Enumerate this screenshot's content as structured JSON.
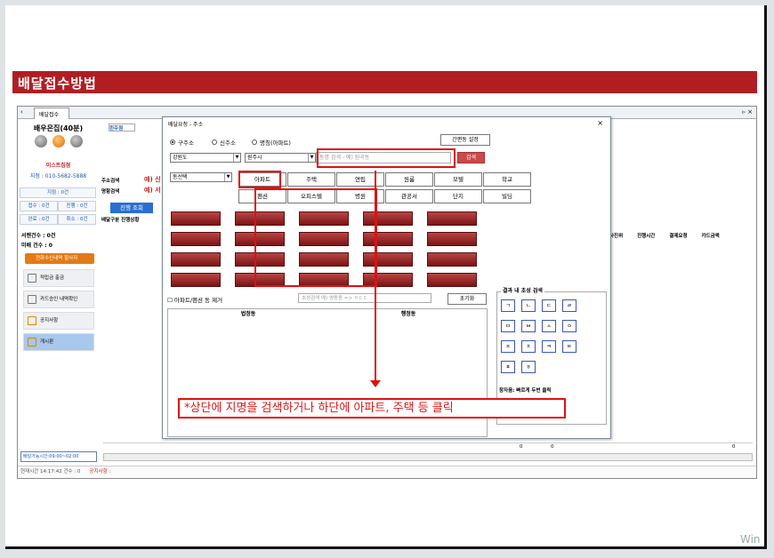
{
  "banner": {
    "title": "배달접수방법"
  },
  "app": {
    "tab": "배달접수",
    "store_name": "배우은집(40분)",
    "store_label": "이스트집점",
    "phone": "지점 : 010-5682-5888",
    "stats": [
      [
        "지점 : 0건"
      ],
      [
        "접수 : 0건",
        "진행 : 0건"
      ],
      [
        "완료 : 0건",
        "취소 : 0건"
      ]
    ],
    "counts": [
      "서렌건수 : 0건",
      "미배 건수 : 0"
    ],
    "orange_btn": "전화수신내역 할사자",
    "menu": [
      "적립금 출금",
      "카드승인 내역확인",
      "공지사항",
      "게시판"
    ],
    "delivery_time": "배달가능시간:09:00~02:00",
    "status_text": "현재시간 14:17:42   건수 : 0",
    "status_notice": "공지사항 :",
    "mid_labels": [
      "왼주점",
      "주소검색",
      "명함검색",
      "배달구분  진행상황",
      "진행 조회",
      "예) 신",
      "예) 서"
    ],
    "grid_headers": [
      "사진위",
      "진행시간",
      "결제요청",
      "카드금액"
    ],
    "totals": [
      "0",
      "0",
      "0"
    ]
  },
  "dialog": {
    "title": "배달요청 - 주소",
    "close": "×",
    "radios": [
      "구주소",
      "신주소",
      "명칭(아파트)"
    ],
    "manage_btn": "간편동 설정",
    "region1": "강원도",
    "region2": "원주시",
    "region3": "동선택",
    "search_placeholder": "동명 검색 - 예) 원곡동",
    "search_btn": "검색",
    "categories_row1": [
      "아파트",
      "주택",
      "연립",
      "원룸",
      "모텔",
      "학교"
    ],
    "categories_row2": [
      "펜션",
      "오피스텔",
      "병원",
      "관공서",
      "단지",
      "빌딩"
    ],
    "checkbox_label": "아파트/펜션 동 제거",
    "small_input_placeholder": "초성검색 예) 영동동 => ㅇㄷㄷ",
    "reset_btn": "초기화",
    "table_headers": [
      "법정동",
      "행정동"
    ],
    "cons_title": "결과 내 초성 검색",
    "consonants": [
      "ㄱ",
      "ㄴ",
      "ㄷ",
      "ㄹ",
      "ㅁ",
      "ㅂ",
      "ㅅ",
      "ㅇ",
      "ㅈ",
      "ㅊ",
      "ㅋ",
      "ㅌ",
      "ㅍ",
      "ㅎ"
    ],
    "cons_hint": "창자음: 빠르게 두번 클릭"
  },
  "callout": "*상단에 지명을 검색하거나 하단에 아파트, 주택 등 클릭",
  "watermark": "Win"
}
